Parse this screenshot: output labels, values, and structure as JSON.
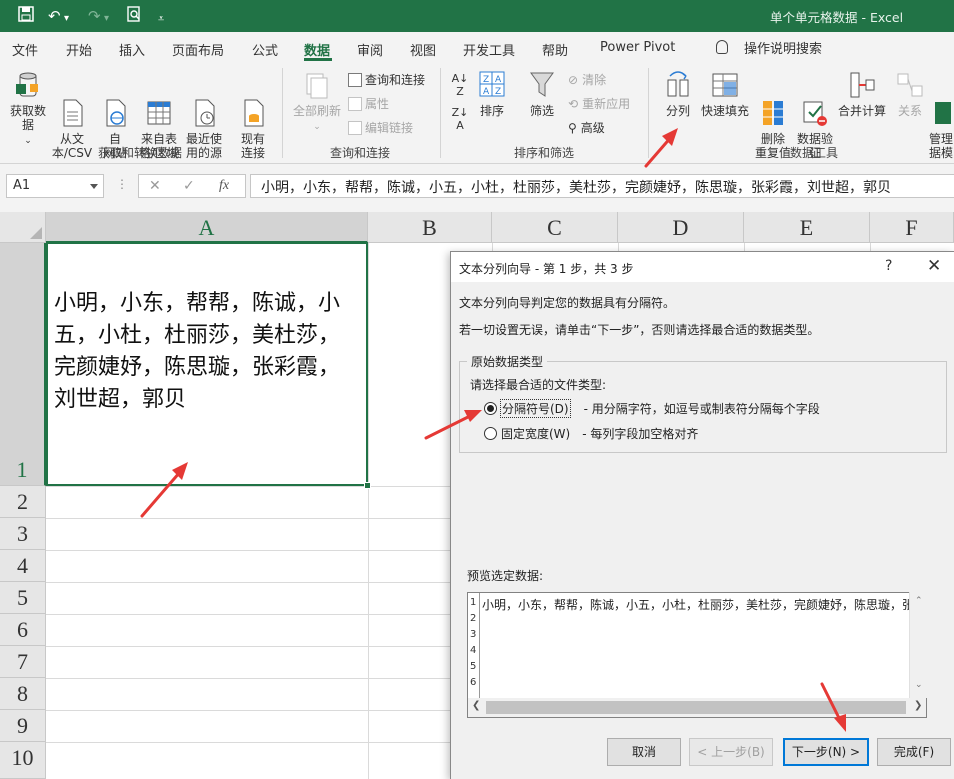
{
  "titlebar": {
    "title": "单个单元格数据  -  Excel",
    "quick_access": [
      "save-icon",
      "undo-icon",
      "redo-icon",
      "print-preview-icon",
      "customize-icon"
    ]
  },
  "tabs": [
    "文件",
    "开始",
    "插入",
    "页面布局",
    "公式",
    "数据",
    "审阅",
    "视图",
    "开发工具",
    "帮助",
    "Power Pivot"
  ],
  "active_tab": "数据",
  "tell_me": "操作说明搜索",
  "ribbon": {
    "get_data": "获取数据",
    "from_text": "从文\n本/CSV",
    "from_web": "自\n网站",
    "from_table": "来自表\n格/区域",
    "recent_sources": "最近使\n用的源",
    "existing_conn": "现有\n连接",
    "group1": "获取和转换数据",
    "refresh_all": "全部刷新",
    "queries_conn": "查询和连接",
    "properties": "属性",
    "edit_links": "编辑链接",
    "group2": "查询和连接",
    "sort": "排序",
    "filter": "筛选",
    "clear": "清除",
    "reapply": "重新应用",
    "advanced": "高级",
    "group3": "排序和筛选",
    "text_to_columns": "分列",
    "flash_fill": "快速填充",
    "remove_dup": "删除\n重复值",
    "data_validation": "数据验\n证",
    "consolidate": "合并计算",
    "relationships": "关系",
    "manage": "管理\n据模",
    "group4": "数据工具"
  },
  "formula_bar": {
    "name_box": "A1",
    "content": "小明，小东，帮帮，陈诚，小五，小杜，杜丽莎，美杜莎，完颜婕妤，陈思璇，张彩霞，刘世超，郭贝"
  },
  "grid": {
    "columns": [
      "A",
      "B",
      "C",
      "D",
      "E",
      "F"
    ],
    "rows": [
      "1",
      "2",
      "3",
      "4",
      "5",
      "6",
      "7",
      "8",
      "9",
      "10"
    ],
    "a1_value": "小明，小东，帮帮，陈诚，小五，小杜，杜丽莎，美杜莎，完颜婕妤，陈思璇，张彩霞，刘世超，郭贝"
  },
  "dialog": {
    "title": "文本分列向导 - 第 1 步，共 3 步",
    "help": "?",
    "line1": "文本分列向导判定您的数据具有分隔符。",
    "line2": "若一切设置无误，请单击“下一步”，否则请选择最合适的数据类型。",
    "group_title": "原始数据类型",
    "prompt": "请选择最合适的文件类型:",
    "option1_label": "分隔符号(D)",
    "option1_desc": "- 用分隔字符，如逗号或制表符分隔每个字段",
    "option2_label": "固定宽度(W)",
    "option2_desc": "- 每列字段加空格对齐",
    "selected_option": "分隔符号(D)",
    "preview_label": "预览选定数据:",
    "preview_rows": [
      "1",
      "2",
      "3",
      "4",
      "5",
      "6"
    ],
    "preview_line": "小明，小东，帮帮，陈诚，小五，小杜，杜丽莎，美杜莎，完颜婕妤，陈思璇，张彩",
    "btn_cancel": "取消",
    "btn_back": "< 上一步(B)",
    "btn_next": "下一步(N) >",
    "btn_finish": "完成(F)"
  },
  "colors": {
    "excel_green": "#217346",
    "annotation_red": "#e53935",
    "focus_blue": "#0078d7"
  }
}
